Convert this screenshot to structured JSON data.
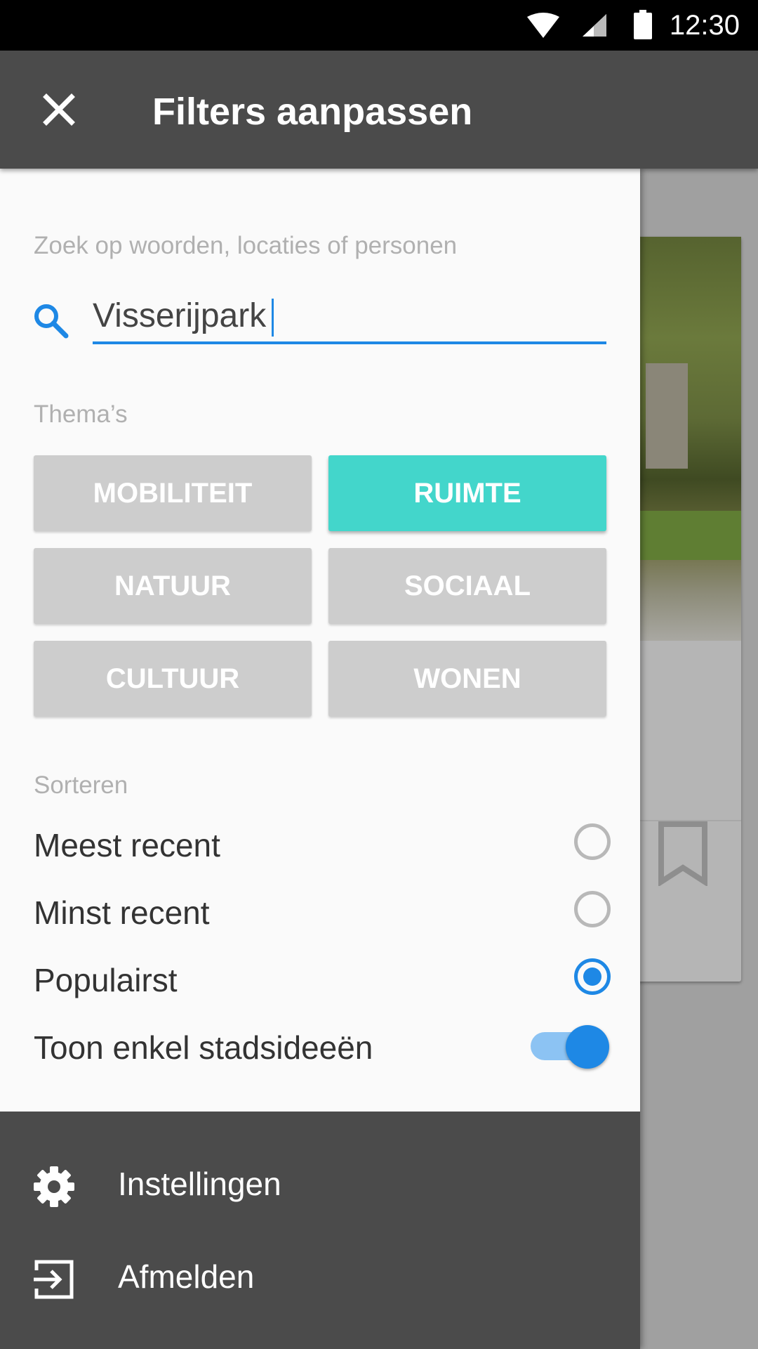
{
  "status_bar": {
    "time": "12:30"
  },
  "app_bar": {
    "title": "Filters aanpassen"
  },
  "search": {
    "hint": "Zoek op woorden, locaties of personen",
    "value": "Visserijpark"
  },
  "themes": {
    "label": "Thema’s",
    "chips": [
      {
        "label": "MOBILITEIT",
        "active": false
      },
      {
        "label": "RUIMTE",
        "active": true
      },
      {
        "label": "NATUUR",
        "active": false
      },
      {
        "label": "SOCIAAL",
        "active": false
      },
      {
        "label": "CULTUUR",
        "active": false
      },
      {
        "label": "WONEN",
        "active": false
      }
    ]
  },
  "sort": {
    "label": "Sorteren",
    "options": [
      {
        "label": "Meest recent",
        "selected": false
      },
      {
        "label": "Minst recent",
        "selected": false
      },
      {
        "label": "Populairst",
        "selected": true
      }
    ]
  },
  "toggle": {
    "label": "Toon enkel stadsideeën",
    "on": true
  },
  "menu": [
    {
      "label": "Instellingen",
      "icon": "gear-icon"
    },
    {
      "label": "Afmelden",
      "icon": "logout-icon"
    }
  ],
  "colors": {
    "accent": "#1e88e5",
    "active_chip": "#43d6cb",
    "app_bar": "#4b4b4b"
  }
}
